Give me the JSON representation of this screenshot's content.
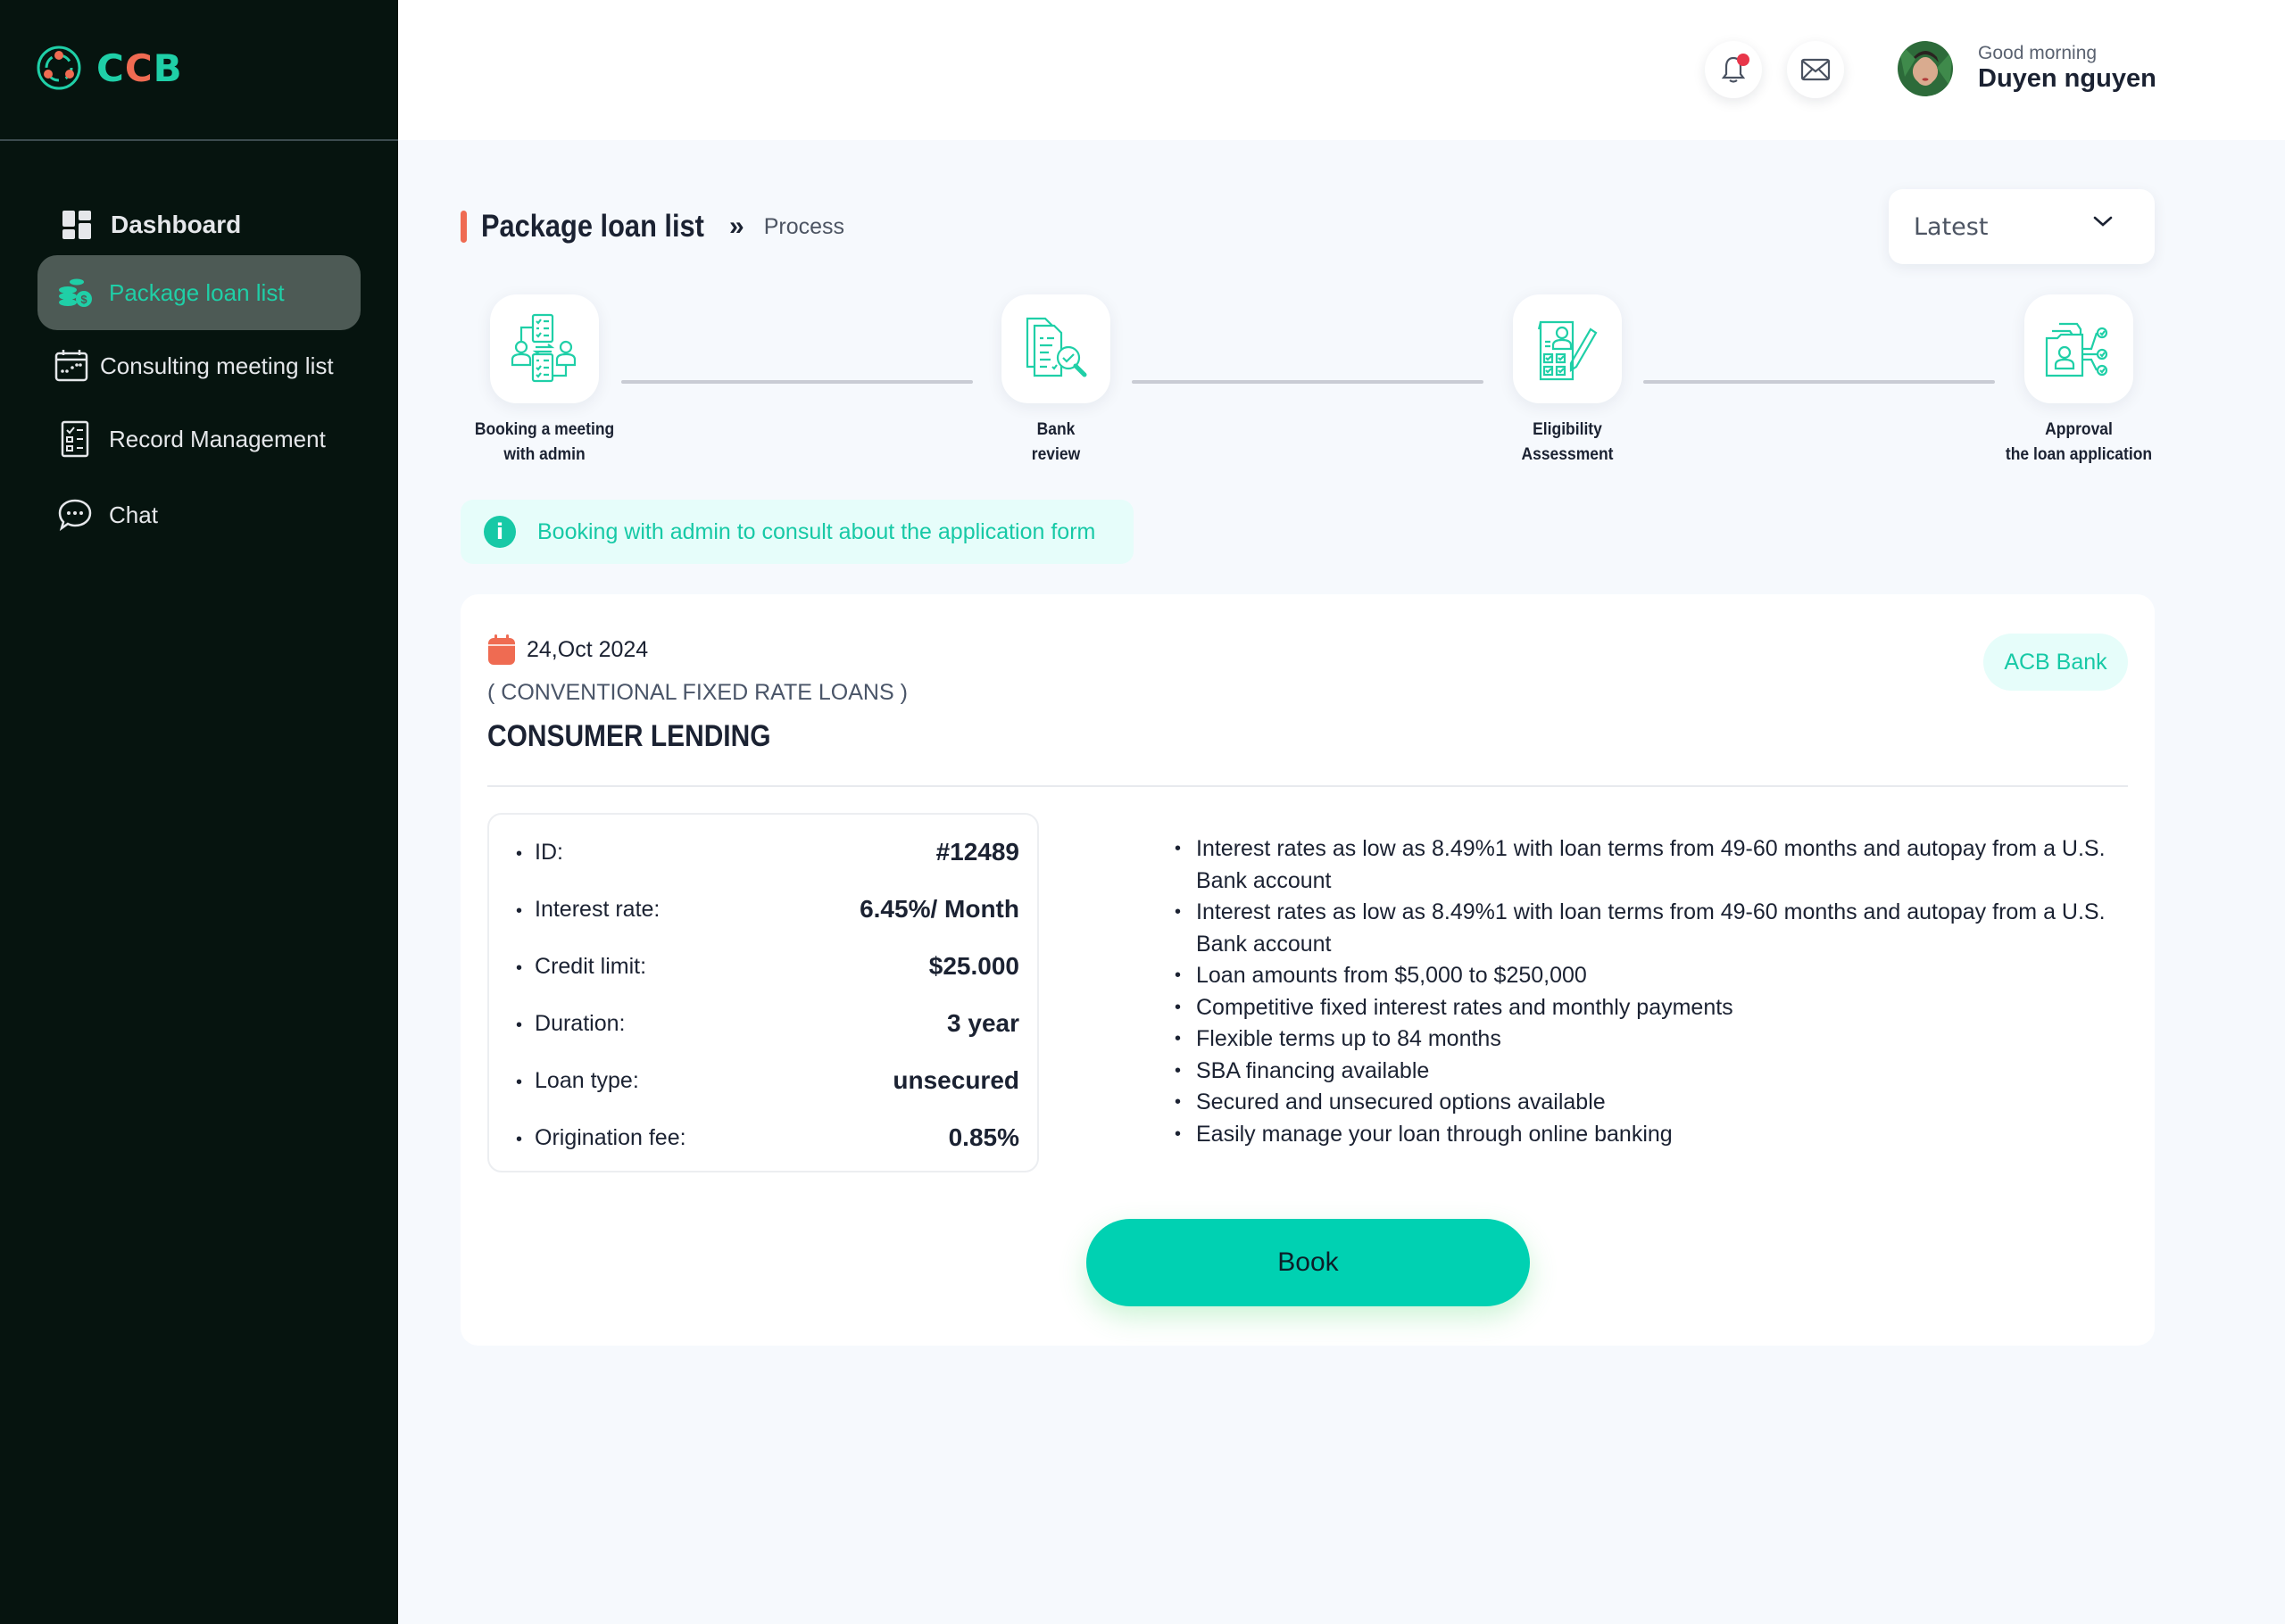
{
  "app": {
    "logo_text": [
      "C",
      "C",
      "B"
    ],
    "brand_colors": {
      "primary": "#1fcfa7",
      "accent": "#ef6b52",
      "sidebar_bg": "#06140f"
    }
  },
  "sidebar": {
    "items": [
      {
        "label": "Dashboard",
        "icon": "dashboard-grid-icon",
        "active": false
      },
      {
        "label": "Package loan list",
        "icon": "coins-dollar-icon",
        "active": true
      },
      {
        "label": "Consulting meeting list",
        "icon": "calendar-icon",
        "active": false
      },
      {
        "label": "Record Management",
        "icon": "checklist-icon",
        "active": false
      },
      {
        "label": "Chat",
        "icon": "chat-bubble-icon",
        "active": false
      }
    ]
  },
  "header": {
    "notification_icon": "bell-icon",
    "notification_unread": true,
    "mail_icon": "envelope-icon",
    "greeting": "Good morning",
    "user_name": "Duyen nguyen"
  },
  "page": {
    "title": "Package loan list",
    "breadcrumb_separator": "»",
    "breadcrumb_current": "Process",
    "sort": {
      "selected": "Latest"
    }
  },
  "steps": [
    {
      "label_line1": "Booking a meeting",
      "label_line2": "with admin",
      "icon": "meeting-exchange-icon"
    },
    {
      "label_line1": "Bank",
      "label_line2": "review",
      "icon": "document-review-icon"
    },
    {
      "label_line1": "Eligibility",
      "label_line2": "Assessment",
      "icon": "eligibility-form-icon"
    },
    {
      "label_line1": "Approval",
      "label_line2": "the loan application",
      "icon": "approval-folder-icon"
    }
  ],
  "info": {
    "icon": "info-icon",
    "text": "Booking with admin to consult about the  application form"
  },
  "loan": {
    "date": "24,Oct 2024",
    "category": "( CONVENTIONAL FIXED RATE LOANS )",
    "name": "CONSUMER LENDING",
    "bank": "ACB Bank",
    "details": [
      {
        "label": "ID:",
        "value": "#12489"
      },
      {
        "label": "Interest rate:",
        "value": "6.45%/ Month"
      },
      {
        "label": "Credit limit:",
        "value": "$25.000"
      },
      {
        "label": "Duration:",
        "value": "3 year"
      },
      {
        "label": "Loan type:",
        "value": "unsecured"
      },
      {
        "label": "Origination fee:",
        "value": "0.85%"
      }
    ],
    "features": [
      "Interest rates as low as 8.49%1 with loan terms from 49-60 months and autopay from a U.S. Bank account",
      "Interest rates as low as 8.49%1 with loan terms from 49-60 months and autopay from a U.S. Bank account",
      "Loan amounts from $5,000 to $250,000",
      "Competitive fixed interest rates and monthly payments",
      "Flexible terms up to 84 months",
      "SBA financing available",
      "Secured and unsecured options available",
      "Easily manage your loan through online banking"
    ],
    "book_label": "Book"
  }
}
